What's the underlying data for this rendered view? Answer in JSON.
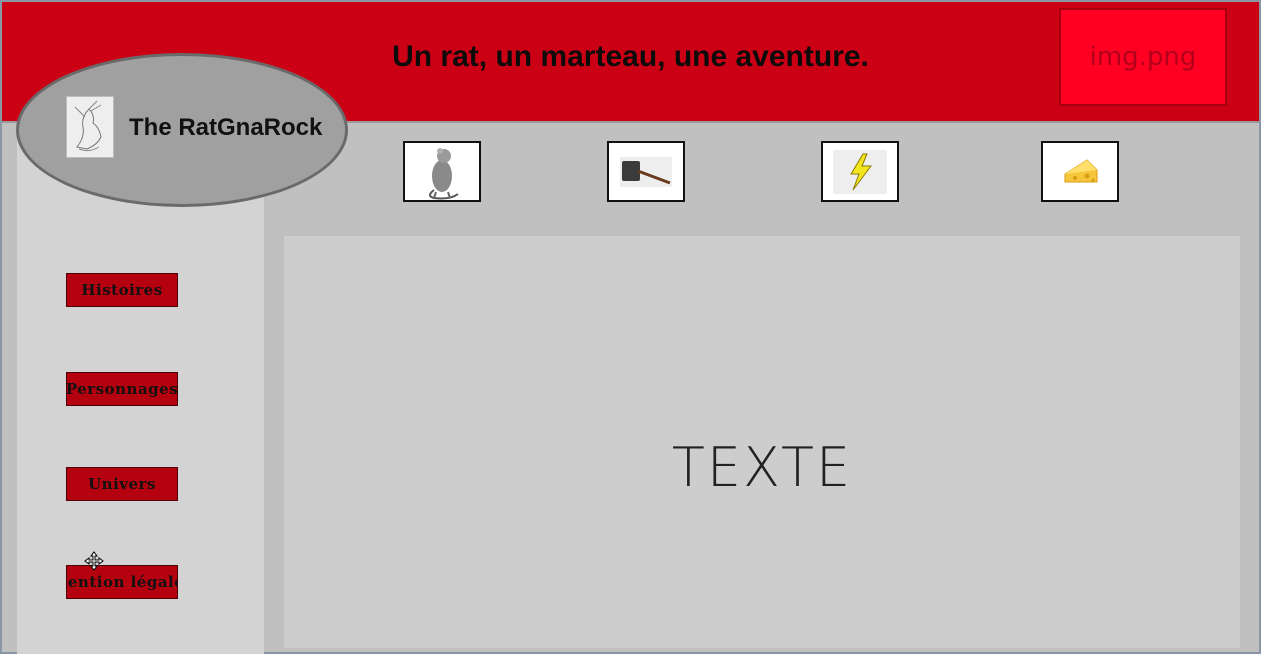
{
  "header": {
    "tagline": "Un rat, un marteau, une aventure.",
    "image_placeholder": "img.png"
  },
  "logo": {
    "brand_name": "The RatGnaRock"
  },
  "icon_row": [
    {
      "icon": "rat-icon"
    },
    {
      "icon": "hammer-icon"
    },
    {
      "icon": "lightning-icon"
    },
    {
      "icon": "cheese-icon"
    }
  ],
  "nav": {
    "items": [
      {
        "label": "Histoires"
      },
      {
        "label": "Personnages"
      },
      {
        "label": "Univers"
      },
      {
        "label": "Mention légales"
      }
    ]
  },
  "main": {
    "text": "TEXTE"
  },
  "colors": {
    "header_red": "#cc0014",
    "button_red": "#b50010",
    "image_placeholder_red": "#ff0022",
    "page_gray": "#c0c0c0"
  }
}
